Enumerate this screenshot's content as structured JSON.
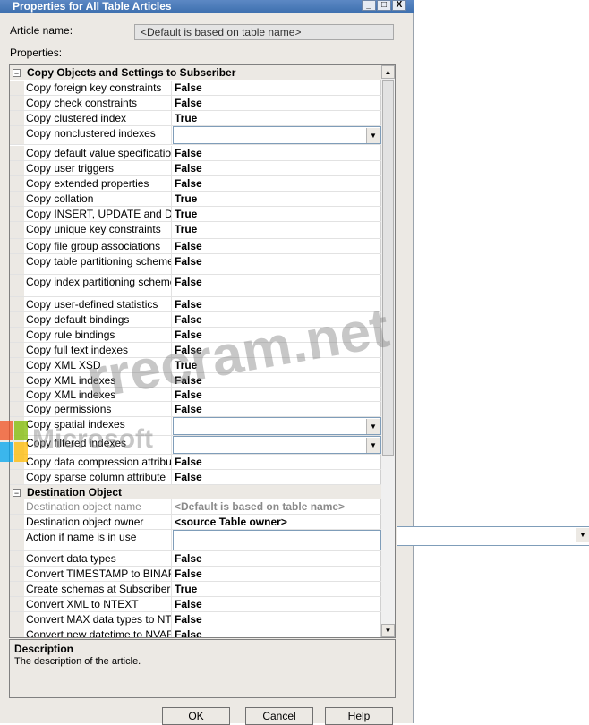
{
  "window": {
    "title": "Properties for All Table Articles",
    "controls": [
      "_",
      "□",
      "X"
    ]
  },
  "article_label": "Article name:",
  "article_value": "<Default is based on table name>",
  "properties_label": "Properties:",
  "categories": {
    "copy": "Copy Objects and Settings to Subscriber",
    "dest": "Destination Object"
  },
  "copy_rows": [
    {
      "name": "Copy foreign key constraints",
      "value": "False"
    },
    {
      "name": "Copy check constraints",
      "value": "False"
    },
    {
      "name": "Copy clustered index",
      "value": "True"
    },
    {
      "name": "Copy nonclustered indexes",
      "value": ""
    },
    {
      "name": "Copy default value specifications",
      "value": "False"
    },
    {
      "name": "Copy user triggers",
      "value": "False"
    },
    {
      "name": "Copy extended properties",
      "value": "False"
    },
    {
      "name": "Copy collation",
      "value": "True"
    },
    {
      "name": "Copy INSERT, UPDATE and DELETE",
      "value": "True"
    },
    {
      "name": "Copy unique key constraints",
      "value": "True"
    },
    {
      "name": "Copy file group associations",
      "value": "False"
    },
    {
      "name": "Copy table partitioning schemes",
      "value": "False"
    },
    {
      "name": "Copy index partitioning schemes",
      "value": "False"
    },
    {
      "name": "Copy user-defined statistics",
      "value": "False"
    },
    {
      "name": "Copy default bindings",
      "value": "False"
    },
    {
      "name": "Copy rule bindings",
      "value": "False"
    },
    {
      "name": "Copy full text indexes",
      "value": "False"
    },
    {
      "name": "Copy XML XSD",
      "value": "True"
    },
    {
      "name": "Copy XML indexes",
      "value": "False"
    },
    {
      "name": "Copy XML indexes",
      "value": "False"
    },
    {
      "name": "Copy permissions",
      "value": "False"
    },
    {
      "name": "Copy spatial indexes",
      "value": ""
    },
    {
      "name": "Copy filtered indexes",
      "value": ""
    },
    {
      "name": "Copy data compression attribute",
      "value": "False"
    },
    {
      "name": "Copy sparse column attribute",
      "value": "False"
    }
  ],
  "dest_rows": [
    {
      "name": "Destination object name",
      "value": "<Default is based on table name>"
    },
    {
      "name": "Destination object owner",
      "value": "<source Table owner>"
    },
    {
      "name": "Action if name is in use",
      "value": ""
    },
    {
      "name": "Convert data types",
      "value": "False"
    },
    {
      "name": "Convert TIMESTAMP to BINARY",
      "value": "False"
    },
    {
      "name": "Create schemas at Subscriber",
      "value": "True"
    },
    {
      "name": "Convert XML to NTEXT",
      "value": "False"
    },
    {
      "name": "Convert MAX data types to NTEXT",
      "value": "False"
    },
    {
      "name": "Convert new datetime to NVARCHAR",
      "value": "False"
    }
  ],
  "description": {
    "title": "Description",
    "text": "The description of the article."
  },
  "buttons": {
    "ok": "OK",
    "cancel": "Cancel",
    "help": "Help"
  },
  "watermarks": {
    "site": "rrecram.net",
    "brand": "Microsoft"
  },
  "colors": {
    "titlebar": "#3d6fae",
    "dialog": "#ece9e4",
    "grid_bg": "#ffffff"
  }
}
